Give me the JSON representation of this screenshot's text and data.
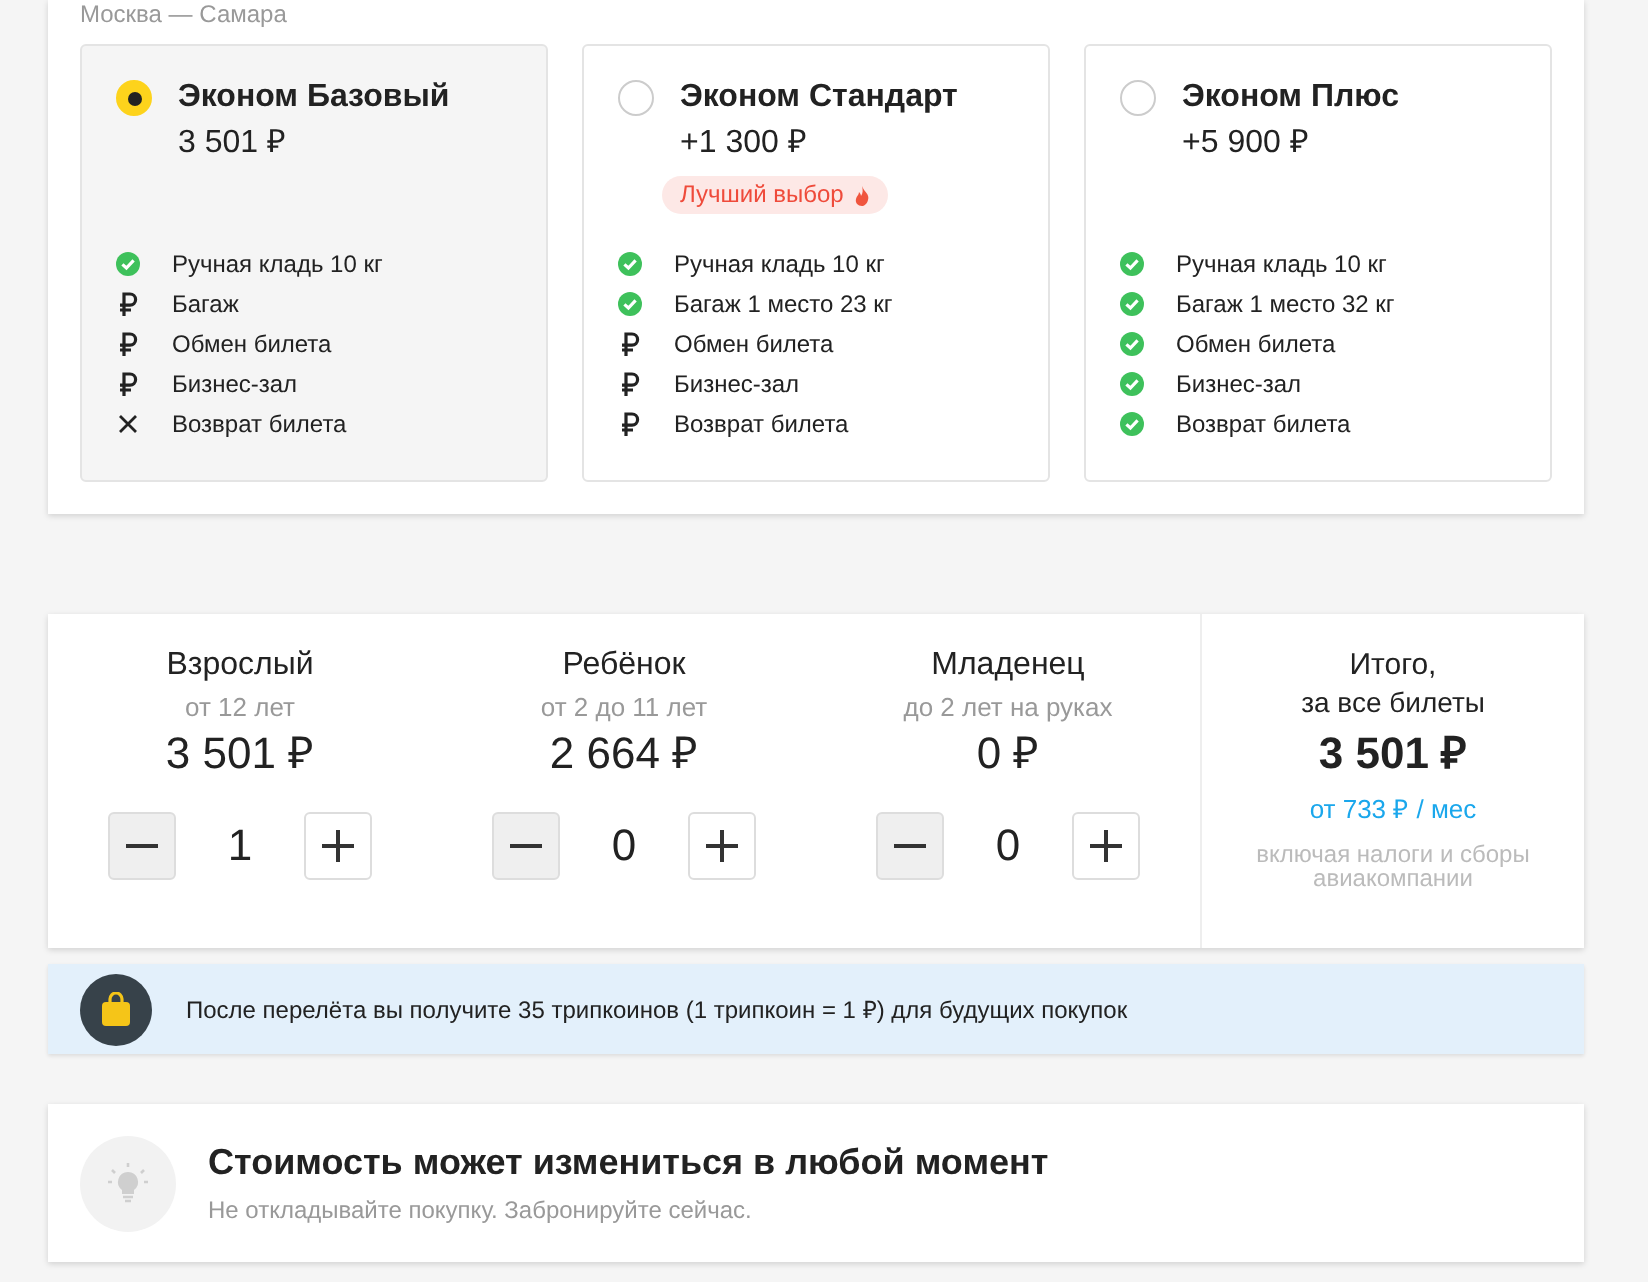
{
  "route": "Москва — Самара",
  "fares": [
    {
      "name": "Эконом Базовый",
      "price": "3 501 ₽",
      "selected": true,
      "features": [
        {
          "kind": "included",
          "label": "Ручная кладь 10 кг"
        },
        {
          "kind": "paid",
          "label": "Багаж"
        },
        {
          "kind": "paid",
          "label": "Обмен билета"
        },
        {
          "kind": "paid",
          "label": "Бизнес-зал"
        },
        {
          "kind": "none",
          "label": "Возврат билета"
        }
      ]
    },
    {
      "name": "Эконом Стандарт",
      "price": "+1 300 ₽",
      "selected": false,
      "badge": "Лучший выбор",
      "features": [
        {
          "kind": "included",
          "label": "Ручная кладь 10 кг"
        },
        {
          "kind": "included",
          "label": "Багаж 1 место 23 кг"
        },
        {
          "kind": "paid",
          "label": "Обмен билета"
        },
        {
          "kind": "paid",
          "label": "Бизнес-зал"
        },
        {
          "kind": "paid",
          "label": "Возврат билета"
        }
      ]
    },
    {
      "name": "Эконом Плюс",
      "price": "+5 900 ₽",
      "selected": false,
      "features": [
        {
          "kind": "included",
          "label": "Ручная кладь 10 кг"
        },
        {
          "kind": "included",
          "label": "Багаж 1 место 32 кг"
        },
        {
          "kind": "included",
          "label": "Обмен билета"
        },
        {
          "kind": "included",
          "label": "Бизнес-зал"
        },
        {
          "kind": "included",
          "label": "Возврат билета"
        }
      ]
    }
  ],
  "passengers": [
    {
      "type": "Взрослый",
      "age": "от 12 лет",
      "price": "3 501 ₽",
      "count": "1",
      "minus_disabled": true
    },
    {
      "type": "Ребёнок",
      "age": "от 2 до 11 лет",
      "price": "2 664 ₽",
      "count": "0",
      "minus_disabled": true
    },
    {
      "type": "Младенец",
      "age": "до 2 лет на руках",
      "price": "0 ₽",
      "count": "0",
      "minus_disabled": true
    }
  ],
  "total": {
    "title": "Итого,",
    "subtitle": "за все билеты",
    "amount": "3 501 ₽",
    "installment": "от 733 ₽ / мес",
    "note": "включая налоги и сборы авиакомпании"
  },
  "bonus_banner": {
    "text": "После перелёта вы получите 35 трипкоинов (1 трипкоин = 1 ₽) для будущих покупок"
  },
  "price_warning": {
    "title": "Стоимость может измениться в любой момент",
    "subtitle": "Не откладывайте покупку. Забронируйте сейчас."
  }
}
